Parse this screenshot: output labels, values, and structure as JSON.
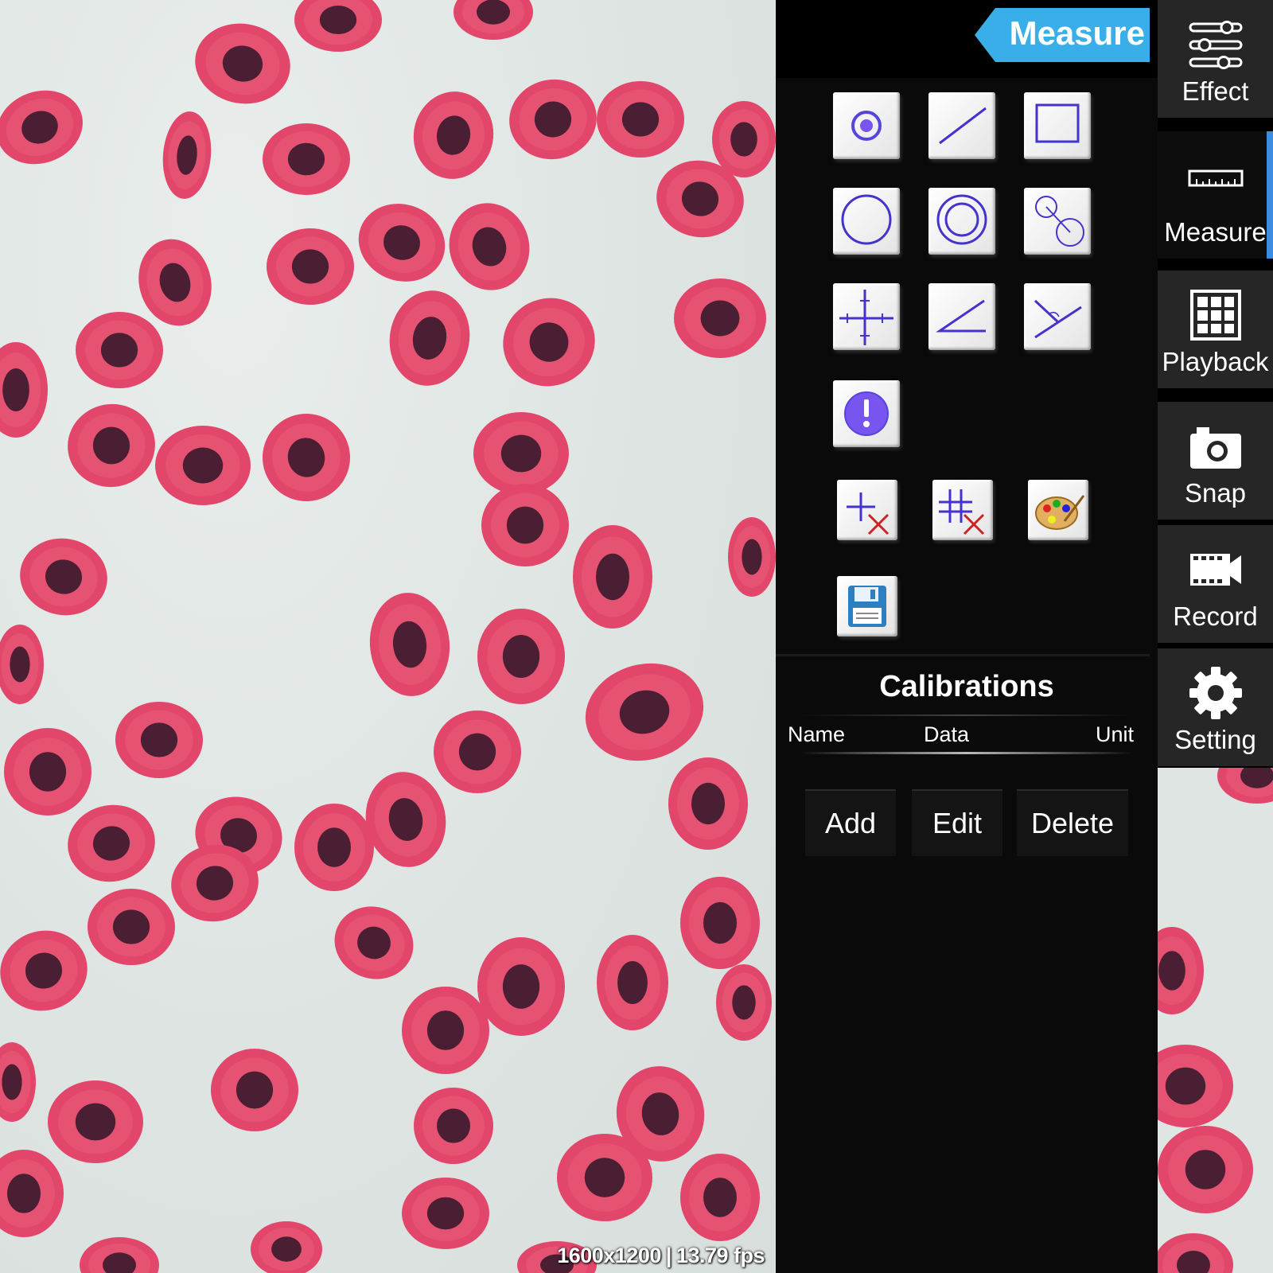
{
  "viewer": {
    "resolution": "1600x1200",
    "fps": "13.79 fps"
  },
  "panel": {
    "header_label": "Measure",
    "tools": [
      "point-tool",
      "line-tool",
      "rectangle-tool",
      "circle-tool",
      "concentric-circle-tool",
      "circle-distance-tool",
      "cross-line-tool",
      "angle-tool",
      "three-point-angle-tool",
      "info-tool",
      "delete-measure-tool",
      "delete-all-tool",
      "color-palette-tool",
      "save-tool"
    ],
    "calibrations": {
      "title": "Calibrations",
      "columns": [
        "Name",
        "Data",
        "Unit"
      ],
      "buttons": {
        "add": "Add",
        "edit": "Edit",
        "delete": "Delete"
      }
    }
  },
  "nav": {
    "items": [
      {
        "label": "Effect",
        "icon": "sliders-icon"
      },
      {
        "label": "Measure",
        "icon": "ruler-icon",
        "active": true
      },
      {
        "label": "Playback",
        "icon": "grid-icon"
      },
      {
        "label": "Snap",
        "icon": "camera-icon"
      },
      {
        "label": "Record",
        "icon": "video-icon"
      },
      {
        "label": "Setting",
        "icon": "gear-icon"
      }
    ]
  },
  "colors": {
    "accent": "#3aaee8",
    "cell": "#e2466a",
    "nucleus": "#4a1f33",
    "tool_stroke": "#4433cc"
  }
}
